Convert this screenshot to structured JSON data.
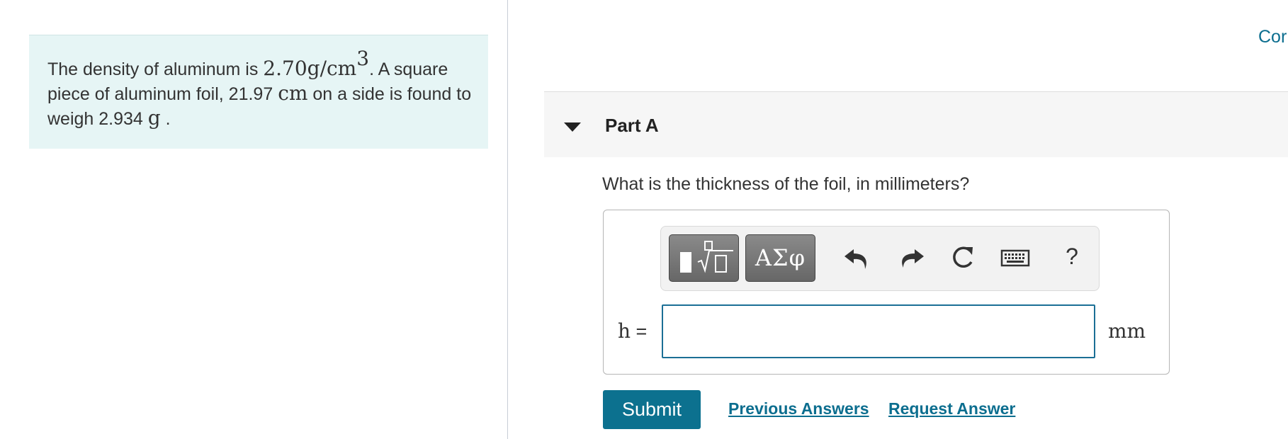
{
  "problem": {
    "intro": "The density of aluminum is ",
    "density_value": "2.70g/cm",
    "density_exponent": "3",
    "after_density": ". A square piece of aluminum foil, 21.97 ",
    "side_unit": "cm",
    "after_side": " on a side is found to weigh 2.934 ",
    "mass_unit": "g",
    "ending": " ."
  },
  "header": {
    "top_right_link": "Cor"
  },
  "part": {
    "title": "Part A",
    "question": "What is the thickness of the foil, in millimeters?"
  },
  "toolbar": {
    "templates_icon": "fraction-sqrt-templates-icon",
    "greek_label": "ΑΣφ",
    "undo_icon": "undo-icon",
    "redo_icon": "redo-icon",
    "reset_icon": "reset-icon",
    "keyboard_icon": "keyboard-icon",
    "help_label": "?"
  },
  "answer": {
    "variable": "h",
    "equals": " = ",
    "value": "",
    "placeholder": "",
    "unit": "mm"
  },
  "actions": {
    "submit_label": "Submit",
    "previous_answers_label": "Previous Answers",
    "request_answer_label": "Request Answer"
  },
  "colors": {
    "problem_bg": "#e6f5f5",
    "accent": "#0c718f",
    "link": "#0c6e8f",
    "input_border": "#1b6f95"
  }
}
